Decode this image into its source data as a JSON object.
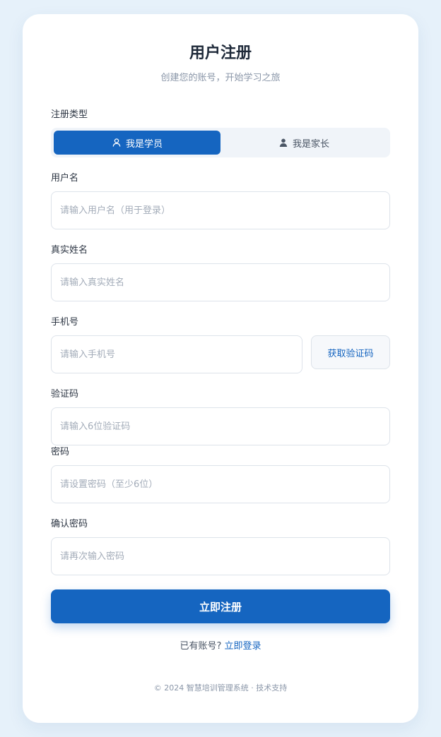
{
  "header": {
    "title": "用户注册",
    "subtitle": "创建您的账号，开始学习之旅"
  },
  "register_type": {
    "label": "注册类型",
    "options": [
      {
        "label": "我是学员",
        "icon": "user-outline-icon",
        "selected": true
      },
      {
        "label": "我是家长",
        "icon": "user-filled-icon",
        "selected": false
      }
    ]
  },
  "fields": {
    "username": {
      "label": "用户名",
      "placeholder": "请输入用户名（用于登录）",
      "value": ""
    },
    "realname": {
      "label": "真实姓名",
      "placeholder": "请输入真实姓名",
      "value": ""
    },
    "phone": {
      "label": "手机号",
      "placeholder": "请输入手机号",
      "value": "",
      "code_button": "获取验证码"
    },
    "code": {
      "label": "验证码",
      "placeholder": "请输入6位验证码",
      "value": ""
    },
    "password": {
      "label": "密码",
      "placeholder": "请设置密码（至少6位）",
      "value": ""
    },
    "confirm": {
      "label": "确认密码",
      "placeholder": "请再次输入密码",
      "value": ""
    }
  },
  "submit_label": "立即注册",
  "login": {
    "prompt": "已有账号?",
    "link": "立即登录"
  },
  "footer": "© 2024 智慧培训管理系统 · 技术支持",
  "colors": {
    "primary": "#1565c0",
    "background": "#e6f1fa"
  }
}
